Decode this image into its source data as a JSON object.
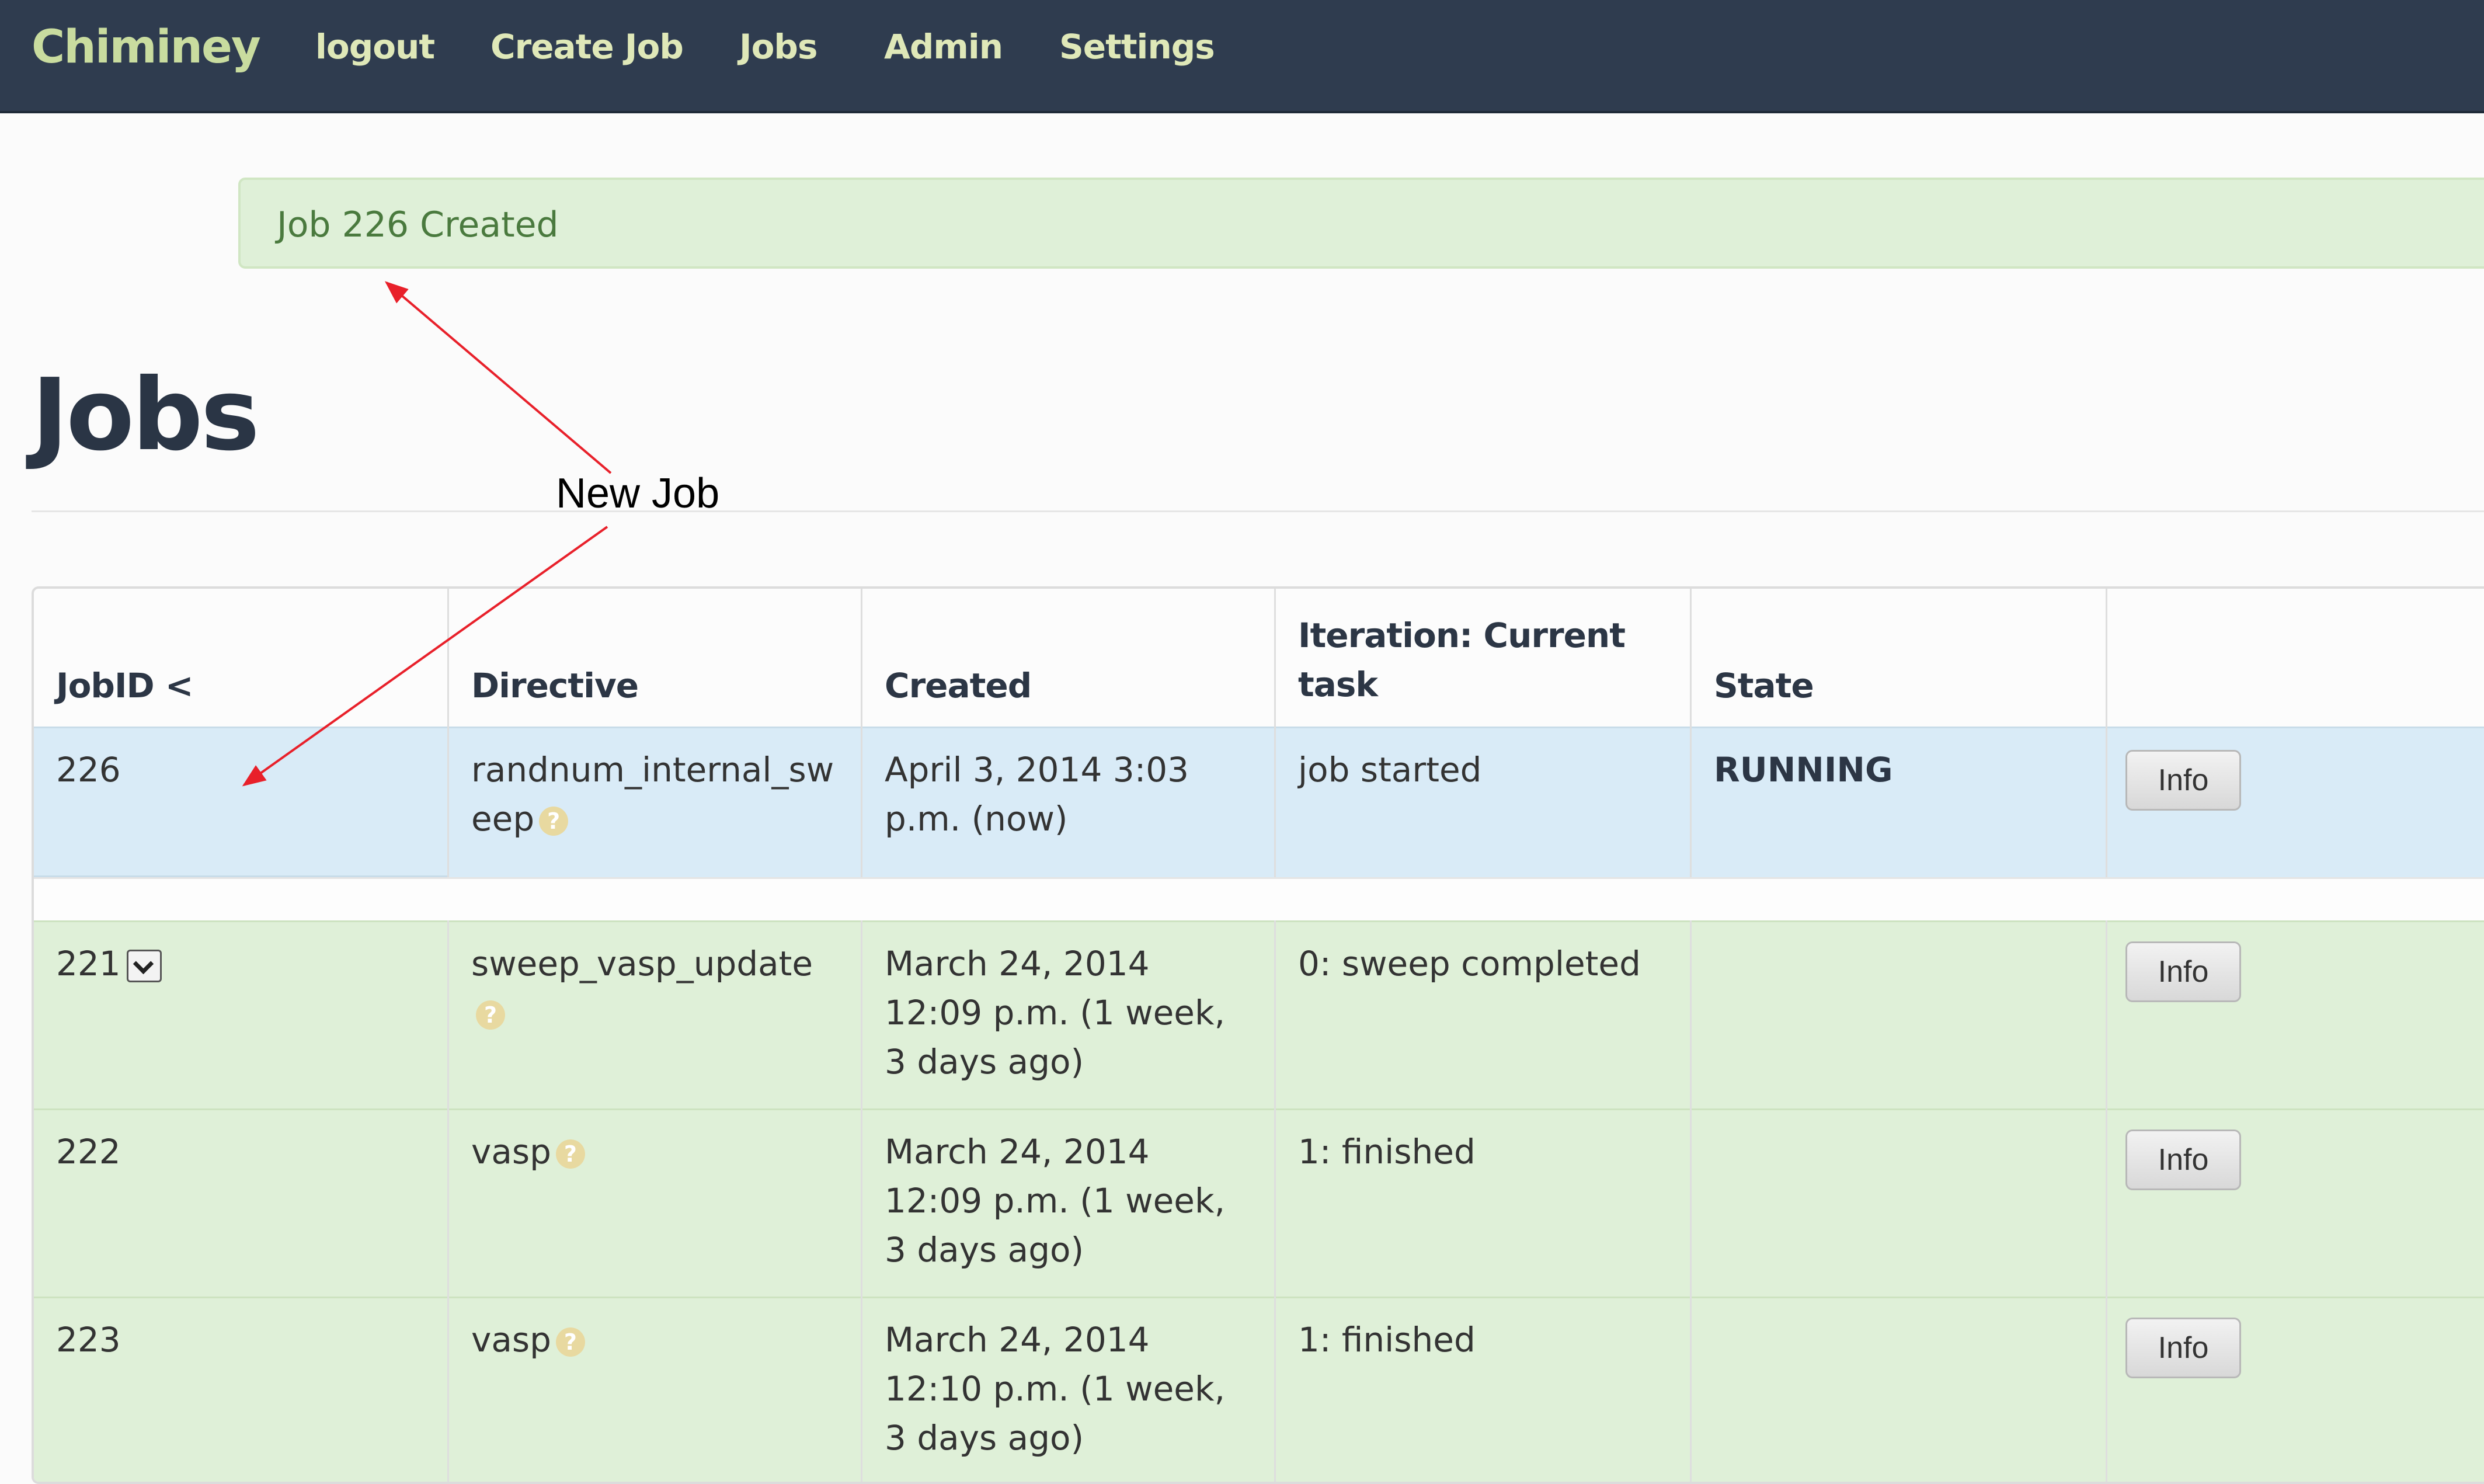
{
  "nav": {
    "brand": "Chiminey",
    "links": [
      "logout",
      "Create Job",
      "Jobs",
      "Admin",
      "Settings"
    ]
  },
  "alert": {
    "text": "Job 226 Created"
  },
  "page": {
    "title": "Jobs"
  },
  "annotation": {
    "text": "New Job"
  },
  "table": {
    "headers": [
      "JobID <",
      "Directive",
      "Created",
      "Iteration: Current task",
      "State",
      ""
    ],
    "rows": [
      {
        "id": "226",
        "directive": "randnum_internal_sweep",
        "created": "April 3, 2014 3:03 p.m. (now)",
        "iteration": "job started",
        "state": "RUNNING",
        "button": "Info"
      },
      {
        "id": "221",
        "directive": "sweep_vasp_update",
        "created": "March 24, 2014 12:09 p.m. (1 week, 3 days ago)",
        "iteration": "0: sweep completed",
        "state": "",
        "button": "Info"
      },
      {
        "id": "222",
        "directive": "vasp",
        "created": "March 24, 2014 12:09 p.m. (1 week, 3 days ago)",
        "iteration": "1: finished",
        "state": "",
        "button": "Info"
      },
      {
        "id": "223",
        "directive": "vasp",
        "created": "March 24, 2014 12:10 p.m. (1 week, 3 days ago)",
        "iteration": "1: finished",
        "state": "",
        "button": "Info"
      }
    ]
  },
  "icons": {
    "help": "question-mark-circle-icon",
    "expand": "chevron-down-icon"
  },
  "colors": {
    "navbar": "#2f3c4f",
    "brand": "#c9dc9f",
    "alert_bg": "#dff0d8",
    "alert_text": "#4a7a3e",
    "running_row": "#d9ebf7",
    "finished_row": "#dff0d8",
    "annotation_arrow": "#e8202a"
  }
}
